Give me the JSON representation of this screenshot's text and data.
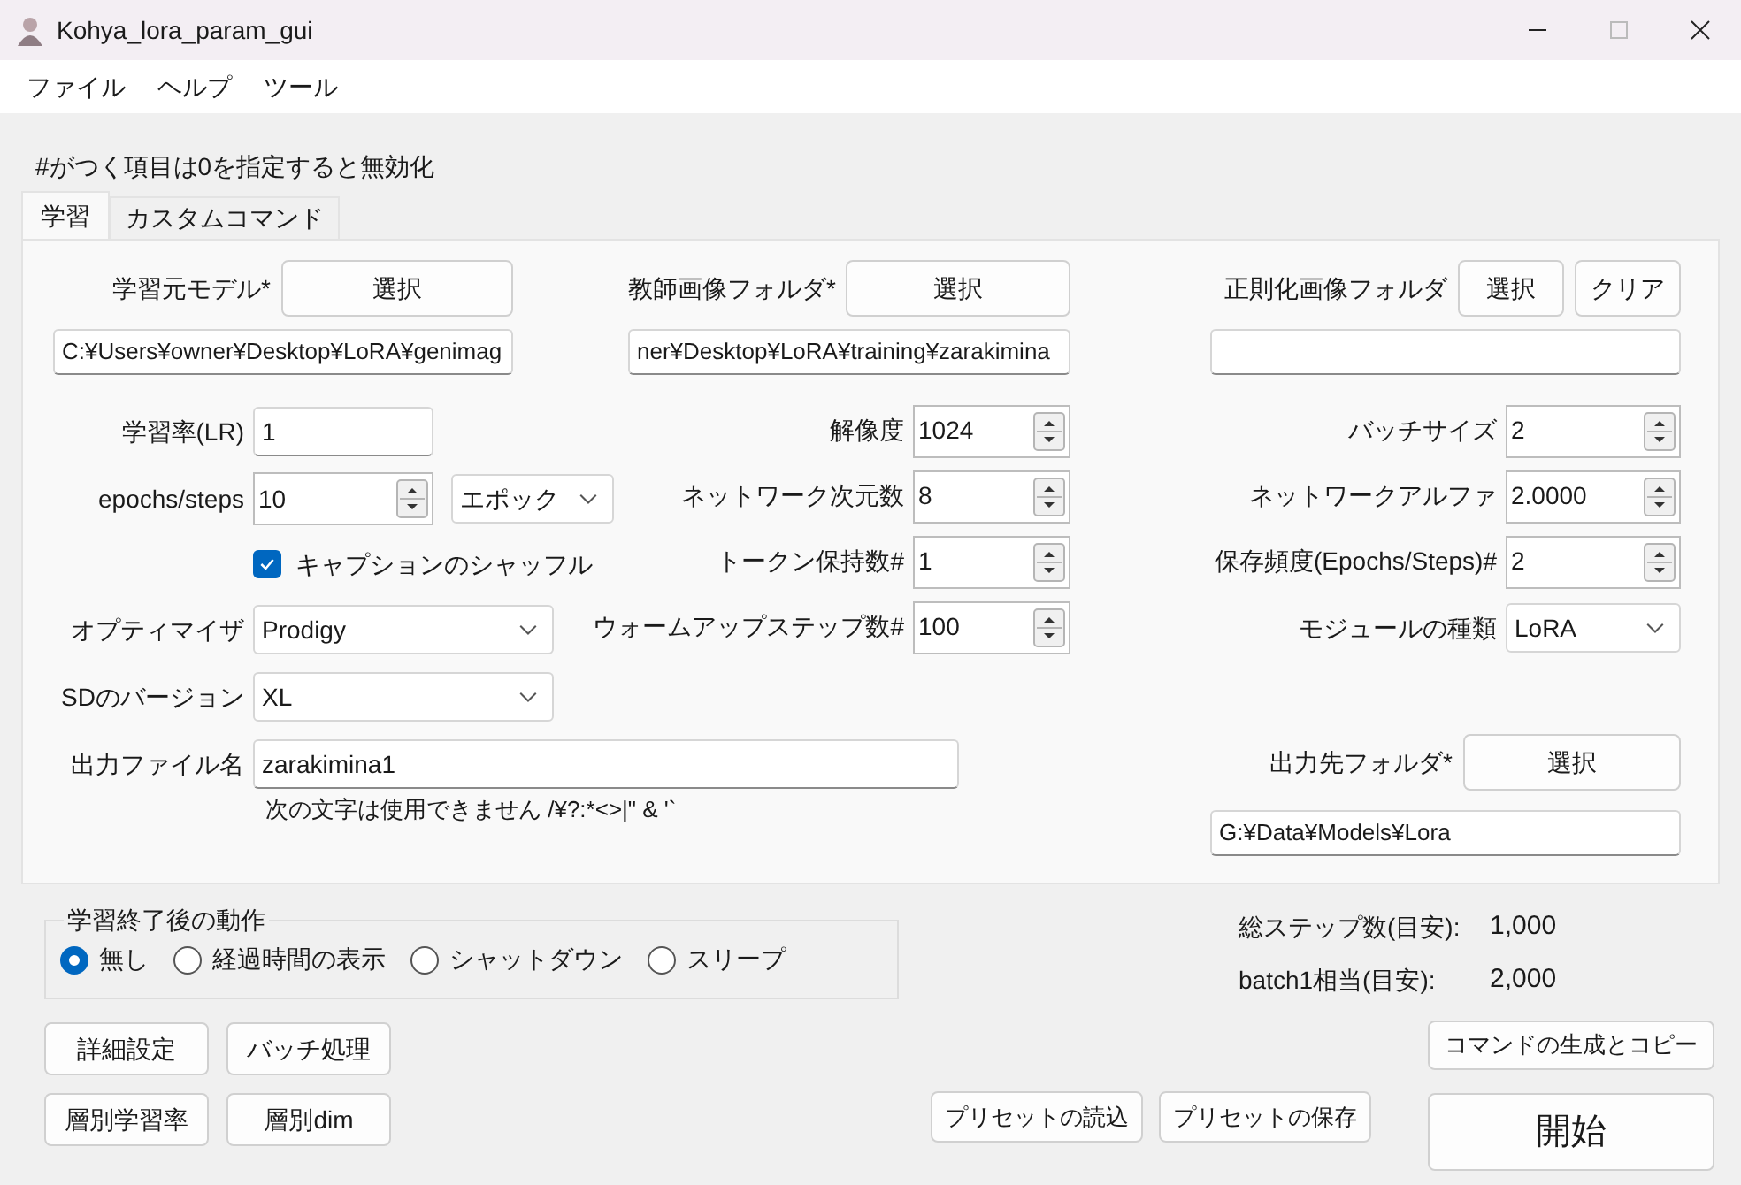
{
  "window": {
    "title": "Kohya_lora_param_gui"
  },
  "menu": [
    "ファイル",
    "ヘルプ",
    "ツール"
  ],
  "note": "#がつく項目は0を指定すると無効化",
  "tabs": [
    {
      "label": "学習",
      "selected": true
    },
    {
      "label": "カスタムコマンド",
      "selected": false
    }
  ],
  "columns": [
    {
      "rows": [
        {
          "kind": "picker",
          "label": "学習元モデル*",
          "buttons": [
            "選択"
          ]
        },
        {
          "kind": "path",
          "value": "C:¥Users¥owner¥Desktop¥LoRA¥genimag"
        },
        {
          "kind": "text",
          "label": "学習率(LR)",
          "value": "1"
        },
        {
          "kind": "spin_select",
          "label": "epochs/steps",
          "value": "10",
          "option": "エポック"
        },
        {
          "kind": "checkbox",
          "label": "キャプションのシャッフル",
          "checked": true
        },
        {
          "kind": "select",
          "label": "オプティマイザ",
          "value": "Prodigy"
        },
        {
          "kind": "select",
          "label": "SDのバージョン",
          "value": "XL"
        },
        {
          "kind": "long_text",
          "label": "出力ファイル名",
          "value": "zarakimina1",
          "hint": "次の文字は使用できません /¥?:*<>|\" & '`"
        }
      ]
    },
    {
      "rows": [
        {
          "kind": "picker",
          "label": "教師画像フォルダ*",
          "buttons": [
            "選択"
          ]
        },
        {
          "kind": "path",
          "value": "ner¥Desktop¥LoRA¥training¥zarakimina"
        },
        {
          "kind": "spin",
          "label": "解像度",
          "value": "1024"
        },
        {
          "kind": "spin",
          "label": "ネットワーク次元数",
          "value": "8"
        },
        {
          "kind": "spin",
          "label": "トークン保持数#",
          "value": "1"
        },
        {
          "kind": "spin",
          "label": "ウォームアップステップ数#",
          "value": "100"
        }
      ]
    },
    {
      "rows": [
        {
          "kind": "picker",
          "label": "正則化画像フォルダ",
          "buttons": [
            "選択",
            "クリア"
          ]
        },
        {
          "kind": "path",
          "value": ""
        },
        {
          "kind": "spin",
          "label": "バッチサイズ",
          "value": "2"
        },
        {
          "kind": "spin",
          "label": "ネットワークアルファ",
          "value": "2.0000"
        },
        {
          "kind": "spin",
          "label": "保存頻度(Epochs/Steps)#",
          "value": "2"
        },
        {
          "kind": "select",
          "label": "モジュールの種類",
          "value": "LoRA"
        }
      ],
      "output_rows": [
        {
          "kind": "picker",
          "label": "出力先フォルダ*",
          "buttons": [
            "選択"
          ]
        },
        {
          "kind": "path",
          "value": "G:¥Data¥Models¥Lora"
        }
      ]
    }
  ],
  "after_training": {
    "title": "学習終了後の動作",
    "options": [
      {
        "label": "無し",
        "selected": true
      },
      {
        "label": "経過時間の表示",
        "selected": false
      },
      {
        "label": "シャットダウン",
        "selected": false
      },
      {
        "label": "スリープ",
        "selected": false
      }
    ]
  },
  "estimates": [
    {
      "label": "総ステップ数(目安):",
      "value": "1,000"
    },
    {
      "label": "batch1相当(目安):",
      "value": "2,000"
    }
  ],
  "left_buttons": [
    [
      "詳細設定",
      "バッチ処理"
    ],
    [
      "層別学習率",
      "層別dim"
    ]
  ],
  "preset_buttons": [
    "プリセットの読込",
    "プリセットの保存"
  ],
  "copy_button": "コマンドの生成とコピー",
  "start_button": "開始"
}
